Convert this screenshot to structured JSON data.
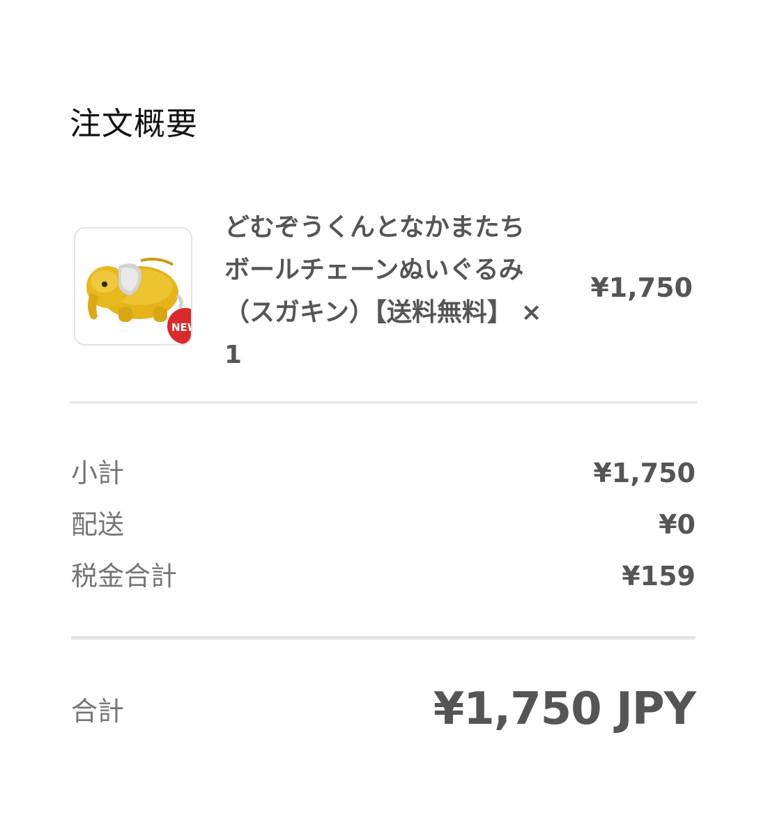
{
  "section_title": "注文概要",
  "item": {
    "name": "どむぞうくんとなかまたち ボールチェーンぬいぐるみ （スガキン）【送料無料】 ×1",
    "price": "¥1,750",
    "thumbnail_icon": "elephant-plush-image",
    "badge_text": "NEW"
  },
  "summary": {
    "subtotal_label": "小計",
    "subtotal_value": "¥1,750",
    "shipping_label": "配送",
    "shipping_value": "¥0",
    "tax_label": "税金合計",
    "tax_value": "¥159"
  },
  "total": {
    "label": "合計",
    "value": "¥1,750 JPY"
  },
  "colors": {
    "text_dark": "#111111",
    "text_value": "#555555",
    "text_label": "#757575",
    "divider": "#e5e5e5",
    "plush_yellow": "#e8b81f",
    "badge_red": "#d92b2b"
  }
}
